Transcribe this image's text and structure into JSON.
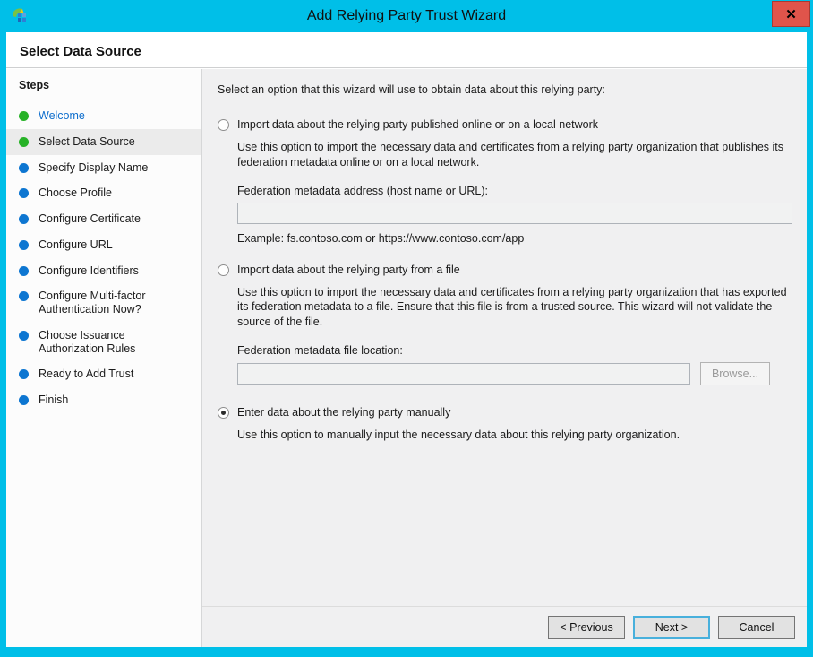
{
  "window": {
    "title": "Add Relying Party Trust Wizard",
    "close_label": "x"
  },
  "page": {
    "title": "Select Data Source"
  },
  "sidebar": {
    "header": "Steps",
    "items": [
      {
        "label": "Welcome",
        "state": "completed",
        "current": false
      },
      {
        "label": "Select Data Source",
        "state": "completed",
        "current": true
      },
      {
        "label": "Specify Display Name",
        "state": "upcoming",
        "current": false
      },
      {
        "label": "Choose Profile",
        "state": "upcoming",
        "current": false
      },
      {
        "label": "Configure Certificate",
        "state": "upcoming",
        "current": false
      },
      {
        "label": "Configure URL",
        "state": "upcoming",
        "current": false
      },
      {
        "label": "Configure Identifiers",
        "state": "upcoming",
        "current": false
      },
      {
        "label": "Configure Multi-factor Authentication Now?",
        "state": "upcoming",
        "current": false
      },
      {
        "label": "Choose Issuance Authorization Rules",
        "state": "upcoming",
        "current": false
      },
      {
        "label": "Ready to Add Trust",
        "state": "upcoming",
        "current": false
      },
      {
        "label": "Finish",
        "state": "upcoming",
        "current": false
      }
    ]
  },
  "content": {
    "intro": "Select an option that this wizard will use to obtain data about this relying party:",
    "options": [
      {
        "label": "Import data about the relying party published online or on a local network",
        "selected": false,
        "description": "Use this option to import the necessary data and certificates from a relying party organization that publishes its federation metadata online or on a local network.",
        "field_label": "Federation metadata address (host name or URL):",
        "field_value": "",
        "example": "Example: fs.contoso.com or https://www.contoso.com/app"
      },
      {
        "label": "Import data about the relying party from a file",
        "selected": false,
        "description": "Use this option to import the necessary data and certificates from a relying party organization that has exported its federation metadata to a file. Ensure that this file is from a trusted source.  This wizard will not validate the source of the file.",
        "field_label": "Federation metadata file location:",
        "field_value": "",
        "browse_label": "Browse..."
      },
      {
        "label": "Enter data about the relying party manually",
        "selected": true,
        "description": "Use this option to manually input the necessary data about this relying party organization."
      }
    ]
  },
  "footer": {
    "previous_label": "< Previous",
    "next_label": "Next >",
    "cancel_label": "Cancel"
  },
  "colors": {
    "titlebar_accent": "#00bfe8",
    "close_button_red": "#e0544b",
    "completed_bullet_green": "#27b227",
    "upcoming_bullet_blue": "#0d76d1",
    "link_blue": "#0e6ecd",
    "content_panel_gray": "#f0f0f1",
    "next_button_focus_border": "#48b0dc"
  }
}
